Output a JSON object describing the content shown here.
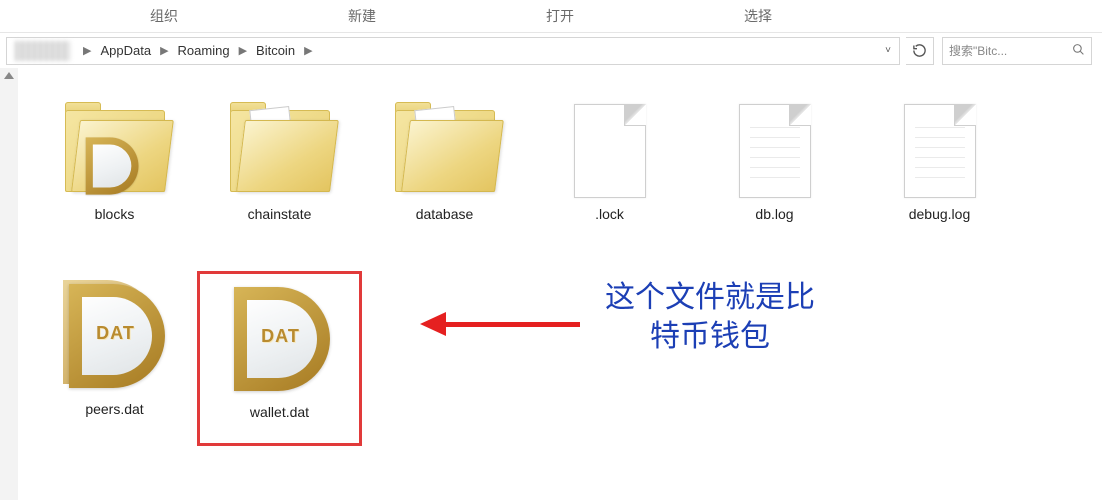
{
  "ribbon": {
    "tabs": [
      "组织",
      "新建",
      "打开",
      "选择"
    ]
  },
  "breadcrumb": [
    "AppData",
    "Roaming",
    "Bitcoin"
  ],
  "search": {
    "placeholder": "搜索\"Bitc..."
  },
  "files": [
    {
      "name": "blocks",
      "type": "folder-dat"
    },
    {
      "name": "chainstate",
      "type": "folder"
    },
    {
      "name": "database",
      "type": "folder"
    },
    {
      "name": ".lock",
      "type": "file-blank"
    },
    {
      "name": "db.log",
      "type": "file-text"
    },
    {
      "name": "debug.log",
      "type": "file-text"
    },
    {
      "name": "peers.dat",
      "type": "dat"
    },
    {
      "name": "wallet.dat",
      "type": "dat",
      "selected": true
    }
  ],
  "dat_label": "DAT",
  "annotation": {
    "line1": "这个文件就是比",
    "line2": "特币钱包"
  }
}
